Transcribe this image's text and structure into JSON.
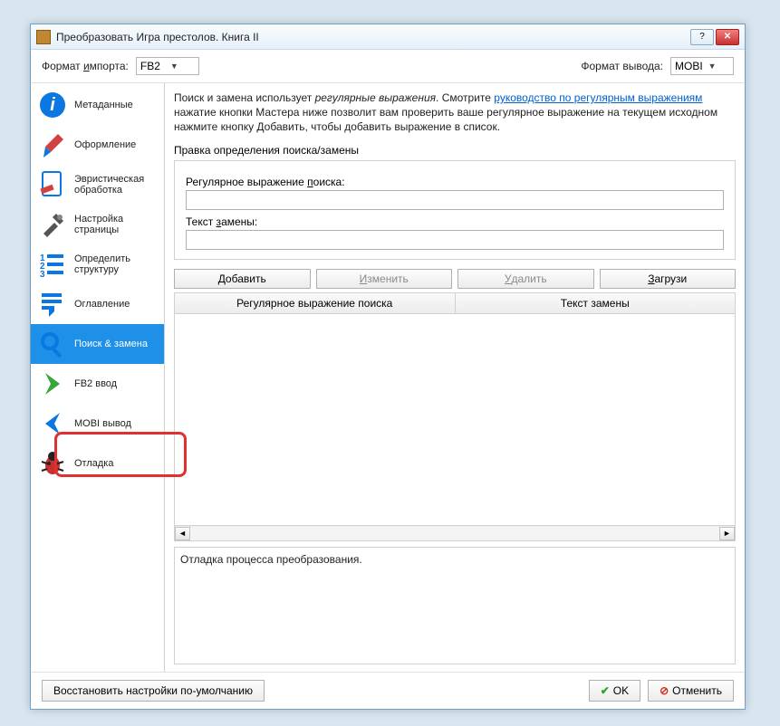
{
  "window": {
    "title": "Преобразовать Игра престолов. Книга II"
  },
  "toolbar": {
    "import_label": "Формат импорта:",
    "import_value": "FB2",
    "output_label": "Формат вывода:",
    "output_value": "MOBI"
  },
  "sidebar": {
    "items": [
      {
        "label": "Метаданные"
      },
      {
        "label": "Оформление"
      },
      {
        "label": "Эвристическая обработка"
      },
      {
        "label": "Настройка страницы"
      },
      {
        "label": "Определить структуру"
      },
      {
        "label": "Оглавление"
      },
      {
        "label": "Поиск & замена"
      },
      {
        "label": "FB2 ввод"
      },
      {
        "label": "MOBI вывод"
      },
      {
        "label": "Отладка"
      }
    ]
  },
  "main": {
    "intro_1": "Поиск и замена использует ",
    "intro_em": "регулярные выражения",
    "intro_2": ". Смотрите ",
    "intro_link": "руководство по регулярным выражениям",
    "intro_3": " нажатие кнопки Мастера ниже позволит вам проверить ваше регулярное выражение на текущем исходном нажмите кнопку Добавить, чтобы добавить выражение в список.",
    "edit_heading": "Правка определения поиска/замены",
    "search_label": "Регулярное выражение поиска:",
    "replace_label": "Текст замены:",
    "search_value": "",
    "replace_value": "",
    "btn_add": "Добавить",
    "btn_edit": "Изменить",
    "btn_delete": "Удалить",
    "btn_load": "Загрузи",
    "col_search": "Регулярное выражение поиска",
    "col_replace": "Текст замены",
    "debug_text": "Отладка процесса преобразования."
  },
  "footer": {
    "restore": "Восстановить настройки по-умолчанию",
    "ok": "OK",
    "cancel": "Отменить"
  }
}
